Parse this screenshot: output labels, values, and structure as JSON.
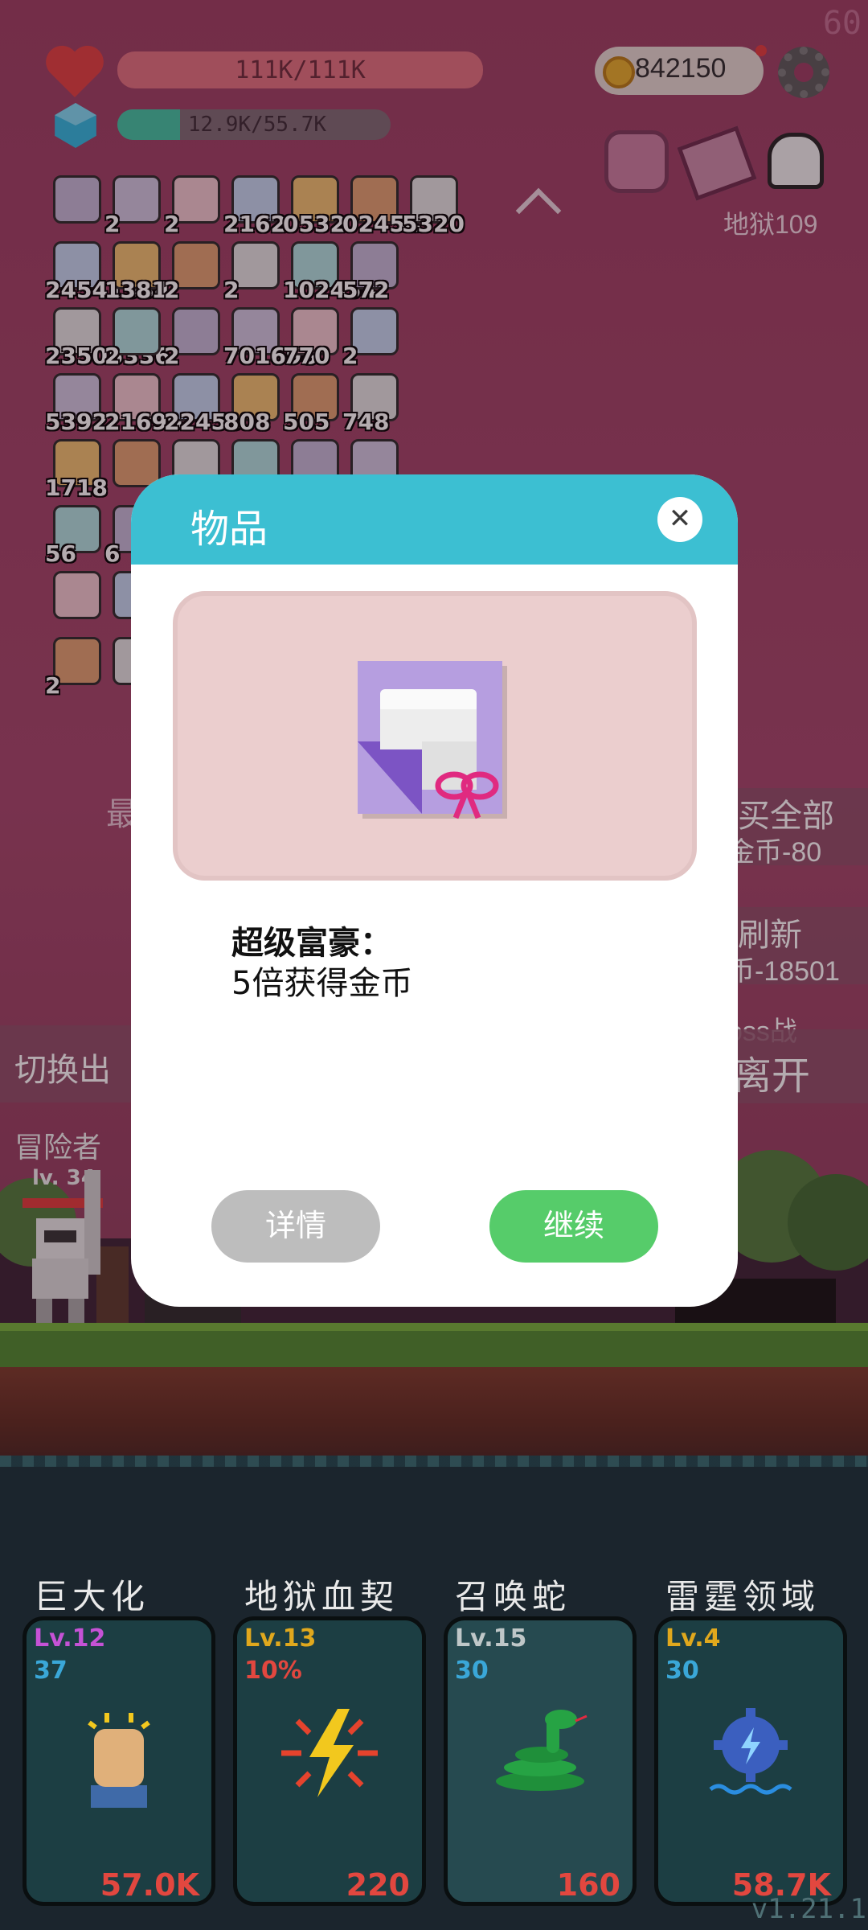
{
  "hud": {
    "fps": "60",
    "hp": "111K/111K",
    "hp_fill": 1.0,
    "mana": "12.9K/55.7K",
    "mana_fill": 0.23,
    "coins": "842150",
    "level_label": "地狱109",
    "version": "v1.21.1"
  },
  "inventory": {
    "rows": [
      [
        "",
        "2",
        "2",
        "2162",
        "0532",
        "02454",
        "5320"
      ],
      [
        "24541534",
        "1381",
        "2",
        "2",
        "102454",
        "572"
      ],
      [
        "23505336",
        "2",
        "2",
        "701698",
        "770",
        "2"
      ],
      [
        "5392",
        "21699",
        "22453",
        "808",
        "505",
        "748"
      ],
      [
        "1718",
        "",
        "",
        "",
        "",
        ""
      ],
      [
        "56",
        "6"
      ],
      [
        "",
        ""
      ],
      [
        "2",
        ""
      ]
    ]
  },
  "background": {
    "side_buttons": [
      {
        "line1": "买全部",
        "line2": "金币-80"
      },
      {
        "line1": "刷新",
        "line2": "币-18501"
      },
      {
        "line1": "oss战",
        "line2": "离开"
      }
    ],
    "left_button": "切换出",
    "left_partial": "最",
    "hero_name": "冒险者",
    "hero_level": "lv. 34"
  },
  "modal": {
    "title": "物品",
    "close_icon": "close-icon",
    "item_icon": "gift-card-icon",
    "item_name": "超级富豪：",
    "item_desc": "5倍获得金币",
    "details_label": "详情",
    "continue_label": "继续",
    "colors": {
      "header": "#3cbfd2",
      "details": "#bdbdbd",
      "continue": "#56cc6a"
    }
  },
  "skills": [
    {
      "title": "巨大化",
      "level": "Lv.12",
      "level_color": "#c552d6",
      "sub": "37",
      "sub_color": "#3aa7d8",
      "cost": "57.0K",
      "icon": "fist-icon"
    },
    {
      "title": "地狱血契",
      "level": "Lv.13",
      "level_color": "#e0a81d",
      "sub": "10%",
      "sub_color": "#e2473f",
      "cost": "220",
      "icon": "lightning-icon"
    },
    {
      "title": "召唤蛇",
      "level": "Lv.15",
      "level_color": "#bfc7c8",
      "sub": "30",
      "sub_color": "#3aa7d8",
      "cost": "160",
      "icon": "snake-icon"
    },
    {
      "title": "雷霆领域",
      "level": "Lv.4",
      "level_color": "#e0a81d",
      "sub": "30",
      "sub_color": "#3aa7d8",
      "cost": "58.7K",
      "icon": "thunder-mine-icon"
    }
  ]
}
